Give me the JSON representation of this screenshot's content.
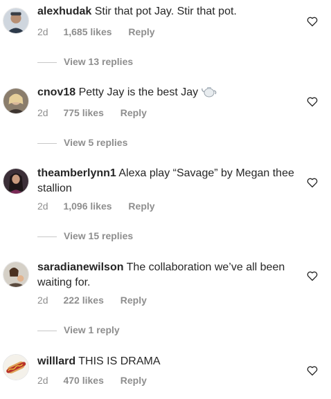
{
  "comments": [
    {
      "username": "alexhudak",
      "text": "Stir that pot Jay. Stir that pot.",
      "age": "2d",
      "likes": "1,685 likes",
      "reply_label": "Reply",
      "view_replies": "View 13 replies",
      "avatar_icon": "avatar-photo-icon"
    },
    {
      "username": "cnov18",
      "text": "Petty Jay is the best Jay",
      "emoji": "teapot-emoji",
      "age": "2d",
      "likes": "775 likes",
      "reply_label": "Reply",
      "view_replies": "View 5 replies",
      "avatar_icon": "avatar-photo-icon"
    },
    {
      "username": "theamberlynn1",
      "text": "Alexa play “Savage”  by Megan thee stallion",
      "age": "2d",
      "likes": "1,096 likes",
      "reply_label": "Reply",
      "view_replies": "View 15 replies",
      "avatar_icon": "avatar-photo-icon"
    },
    {
      "username": "saradianewilson",
      "text": "The collaboration we’ve all been waiting for.",
      "age": "2d",
      "likes": "222 likes",
      "reply_label": "Reply",
      "view_replies": "View 1 reply",
      "avatar_icon": "avatar-photo-icon"
    },
    {
      "username": "willlard",
      "text": "THIS IS DRAMA",
      "age": "2d",
      "likes": "470 likes",
      "reply_label": "Reply",
      "avatar_icon": "hotdog-avatar-icon"
    }
  ],
  "colors": {
    "text": "#262626",
    "meta": "#8e8e8e",
    "divider": "#c7c7c7"
  },
  "icons": {
    "like": "heart-outline-icon"
  }
}
